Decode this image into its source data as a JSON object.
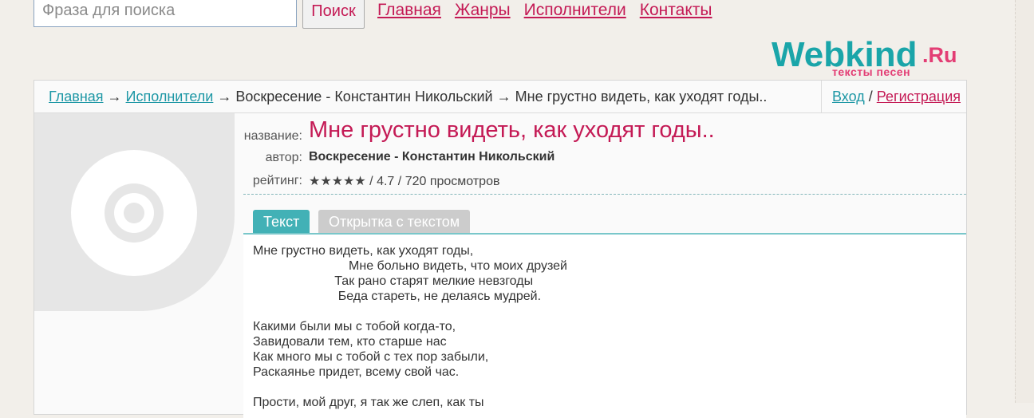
{
  "search": {
    "placeholder": "Фраза для поиска",
    "button": "Поиск"
  },
  "topnav": [
    "Главная",
    "Жанры",
    "Исполнители",
    "Контакты"
  ],
  "logo": {
    "main": "Webkind",
    "ru": ".Ru",
    "sub": "тексты песен"
  },
  "breadcrumb": {
    "home": "Главная",
    "sep": "→",
    "artists": "Исполнители",
    "artist": "Воскресение - Константин Никольский",
    "song": "Мне грустно видеть, как уходят годы.."
  },
  "auth": {
    "login": "Вход",
    "sep": "/",
    "register": "Регистрация"
  },
  "song": {
    "title_label": "название:",
    "title": "Мне грустно видеть, как уходят годы..",
    "author_label": "автор:",
    "author": "Воскресение - Константин Никольский",
    "rating_label": "рейтинг:",
    "stars": "★★★★★",
    "rating": "4.7",
    "views": "720 просмотров"
  },
  "tabs": {
    "text": "Текст",
    "card": "Открытка с текстом"
  },
  "lyrics": "Мне грустно видеть, как уходят годы,\n                           Мне больно видеть, что моих друзей\n                       Так рано старят мелкие невзгоды\n                        Беда стареть, не делаясь мудрей.\n\nКакими были мы с тобой когда-то,\nЗавидовали тем, кто старше нас\nКак много мы с тобой с тех пор забыли,\nРаскаянье придет, всему свой час.\n\nПрости, мой друг, я так же слеп, как ты",
  "colors": {
    "accent": "#c41a55",
    "teal": "#1d97a5",
    "tab_active": "#42b1b6",
    "bg": "#f2efea"
  }
}
